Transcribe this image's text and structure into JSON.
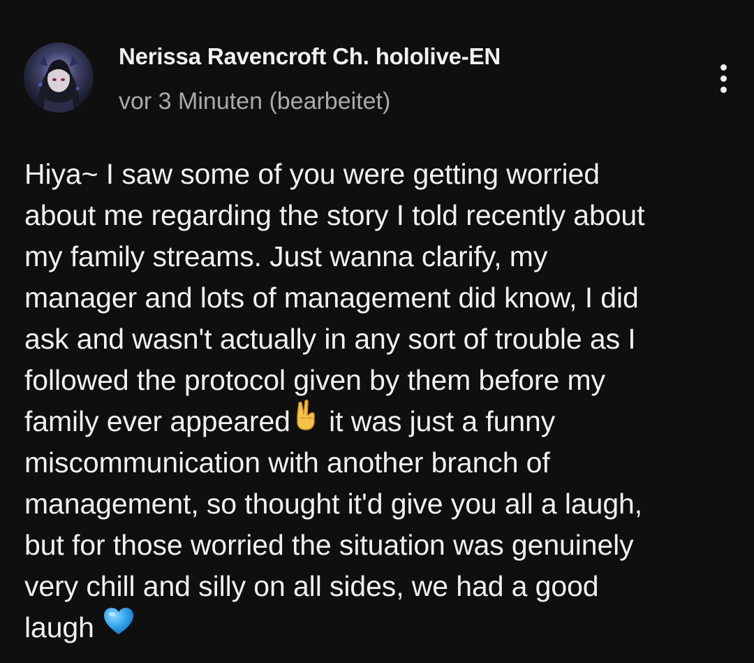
{
  "comment": {
    "author": "Nerissa Ravencroft Ch. hololive-EN",
    "timestamp": "vor 3 Minuten (bearbeitet)",
    "lines": [
      "Hiya~ I saw some of you were getting worried",
      "about me regarding the story I told recently about",
      "my family streams. Just wanna clarify, my",
      "manager and lots of management did know, I did",
      "ask and wasn't actually in any sort of trouble as I",
      "followed the protocol given by them before my",
      "family ever appeared",
      " it was just a funny",
      "miscommunication with another branch of",
      "management, so thought it'd give you all a laugh,",
      "but for those worried the situation was genuinely",
      "very chill and silly on all sides, we had a good",
      "laugh"
    ],
    "emojis": {
      "victory": "victory-hand-icon",
      "heart": "blue-heart-icon"
    }
  },
  "menu": {
    "icon": "more-vertical-icon"
  }
}
